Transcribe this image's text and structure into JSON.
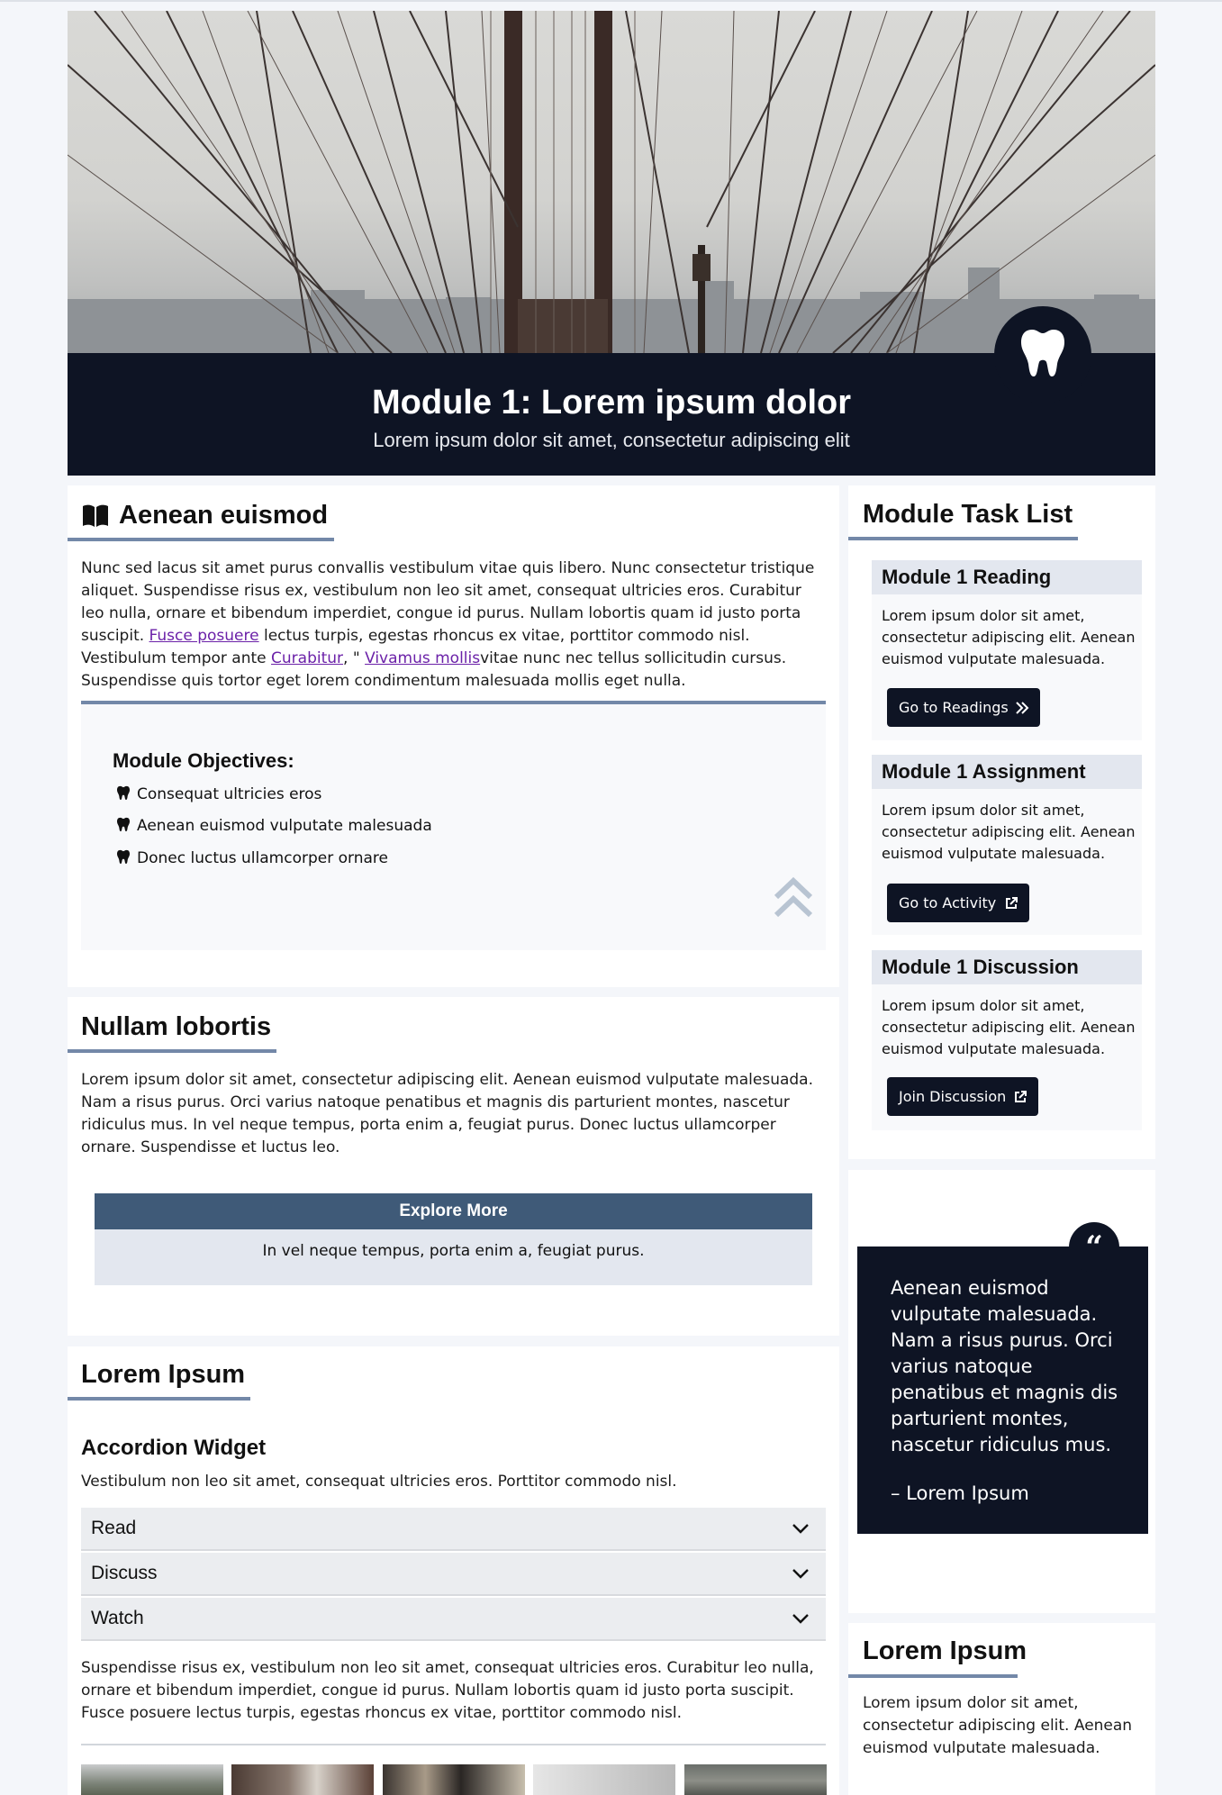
{
  "hero": {
    "title": "Module 1: Lorem ipsum dolor",
    "subtitle": "Lorem ipsum dolor sit amet, consectetur adipiscing elit",
    "badge_icon": "tooth-icon"
  },
  "intro": {
    "title": "Aenean euismod",
    "title_icon": "book-open-icon",
    "text_1": "Nunc sed lacus sit amet purus convallis vestibulum vitae quis libero. Nunc consectetur tristique aliquet. Suspendisse risus ex, vestibulum non leo sit amet, consequat ultricies eros. Curabitur leo nulla, ornare et bibendum imperdiet, congue id purus. Nullam lobortis quam id justo porta suscipit. ",
    "link_1": "Fusce posuere",
    "text_2": " lectus turpis, egestas rhoncus ex vitae, porttitor commodo nisl. Vestibulum tempor ante ",
    "link_2": "Curabitur",
    "text_3": ", \" ",
    "link_3": "Vivamus mollis",
    "text_4": "vitae nunc nec tellus sollicitudin cursus. Suspendisse quis tortor eget lorem condimentum malesuada mollis eget nulla."
  },
  "objectives": {
    "title": "Module Objectives:",
    "items": [
      "Consequat ultricies eros",
      "Aenean euismod vulputate malesuada",
      "Donec luctus ullamcorper ornare"
    ],
    "item_icon": "tooth-icon",
    "back_to_top_icon": "chevrons-up-icon"
  },
  "section2": {
    "title": "Nullam lobortis",
    "text": "Lorem ipsum dolor sit amet, consectetur adipiscing elit. Aenean euismod vulputate malesuada. Nam a risus purus. Orci varius natoque penatibus et magnis dis parturient montes, nascetur ridiculus mus. In vel neque tempus, porta enim a, feugiat purus. Donec luctus ullamcorper ornare. Suspendisse et luctus leo.",
    "explore_title": "Explore More",
    "explore_text": "In vel neque tempus, porta enim a, feugiat purus."
  },
  "section3": {
    "title": "Lorem Ipsum",
    "accordion_title": "Accordion Widget",
    "accordion_intro": "Vestibulum non leo sit amet, consequat ultricies eros. Porttitor commodo nisl.",
    "accordion_items": [
      "Read",
      "Discuss",
      "Watch"
    ],
    "after_text": "Suspendisse risus ex, vestibulum non leo sit amet, consequat ultricies eros. Curabitur leo nulla, ornare et bibendum imperdiet, congue id purus. Nullam lobortis quam id justo porta suscipit. Fusce posuere lectus turpis, egestas rhoncus ex vitae, porttitor commodo nisl."
  },
  "tasks": {
    "title": "Module Task List",
    "items": [
      {
        "title": "Module 1 Reading",
        "text": "Lorem ipsum dolor sit amet, consectetur adipiscing elit. Aenean euismod vulputate malesuada.",
        "button": "Go to Readings",
        "button_icon": "double-chevron-right-icon"
      },
      {
        "title": "Module 1 Assignment",
        "text": "Lorem ipsum dolor sit amet, consectetur adipiscing elit. Aenean euismod vulputate malesuada.",
        "button": "Go to Activity",
        "button_icon": "external-link-icon"
      },
      {
        "title": "Module 1 Discussion",
        "text": "Lorem ipsum dolor sit amet, consectetur adipiscing elit. Aenean euismod vulputate malesuada.",
        "button": "Join Discussion",
        "button_icon": "external-link-icon"
      }
    ]
  },
  "quote": {
    "icon": "quote-icon",
    "text": "Aenean euismod vulputate malesuada. Nam a risus purus. Orci varius natoque penatibus et magnis dis parturient montes, nascetur ridiculus mus.",
    "cite": "– Lorem Ipsum"
  },
  "sidebar_footer": {
    "title": "Lorem Ipsum",
    "text": "Lorem ipsum dolor sit amet, consectetur adipiscing elit. Aenean euismod vulputate malesuada."
  },
  "colors": {
    "navy": "#0e1424",
    "accent_rule": "#7388a8",
    "explore_header": "#3f5a78",
    "link": "#6b21a8"
  }
}
